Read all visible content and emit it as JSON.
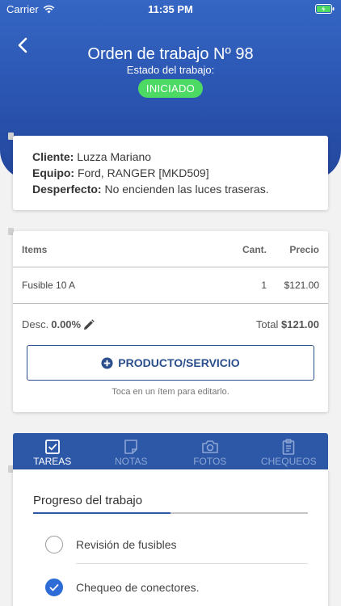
{
  "status_bar": {
    "carrier": "Carrier",
    "time": "11:35 PM"
  },
  "header": {
    "title": "Orden de trabajo Nº 98",
    "subtitle": "Estado del trabajo:",
    "status_badge": "INICIADO"
  },
  "info": {
    "client_label": "Cliente:",
    "client_value": "Luzza Mariano",
    "equipment_label": "Equipo:",
    "equipment_value": "Ford, RANGER [MKD509]",
    "issue_label": "Desperfecto:",
    "issue_value": "No encienden las luces traseras."
  },
  "items": {
    "headers": {
      "name": "Items",
      "qty": "Cant.",
      "price": "Precio"
    },
    "rows": [
      {
        "name": "Fusible 10 A",
        "qty": "1",
        "price": "$121.00"
      }
    ],
    "discount_label": "Desc.",
    "discount_value": "0.00%",
    "total_label": "Total",
    "total_value": "$121.00",
    "add_button": "PRODUCTO/SERVICIO",
    "hint": "Toca en un ítem para editarlo."
  },
  "tabs": [
    {
      "label": "TAREAS",
      "icon": "checkbox-icon",
      "active": true
    },
    {
      "label": "NOTAS",
      "icon": "note-icon",
      "active": false
    },
    {
      "label": "FOTOS",
      "icon": "camera-icon",
      "active": false
    },
    {
      "label": "CHEQUEOS",
      "icon": "clipboard-icon",
      "active": false
    }
  ],
  "tasks": {
    "progress_label": "Progreso del trabajo",
    "progress_fraction": 0.5,
    "items": [
      {
        "label": "Revisión de fusibles",
        "done": false
      },
      {
        "label": "Chequeo de conectores.",
        "done": true
      }
    ]
  },
  "colors": {
    "header": "#2a54b0",
    "badge": "#4cd964",
    "accent": "#2d58a8",
    "check": "#2d6cd6"
  }
}
